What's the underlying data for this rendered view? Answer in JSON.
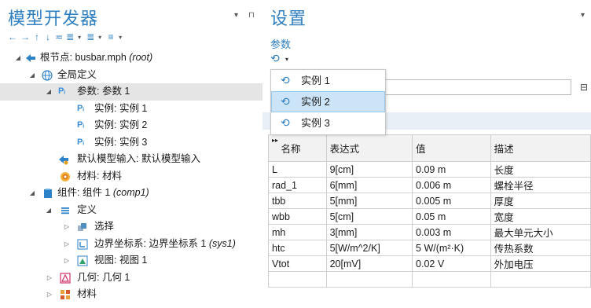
{
  "left_panel": {
    "title": "模型开发器",
    "title_controls": [
      "▾",
      "⊓"
    ],
    "toolbar": [
      "←",
      "→",
      "↑",
      "↓",
      "≂",
      "≣",
      "▾",
      "≣",
      "▾",
      "≡",
      "▾"
    ],
    "tree": [
      {
        "label": "根节点: busbar.mph",
        "suffix": "(root)",
        "icon": "root-node-icon",
        "level": 0,
        "expanded": true
      },
      {
        "label": "全局定义",
        "icon": "globe-icon",
        "level": 1,
        "expanded": true
      },
      {
        "label": "参数: 参数 1",
        "icon": "parameter-icon",
        "level": 2,
        "expanded": true,
        "selected": true
      },
      {
        "label": "实例: 实例 1",
        "icon": "parameter-icon",
        "level": 3
      },
      {
        "label": "实例: 实例 2",
        "icon": "parameter-icon",
        "level": 3
      },
      {
        "label": "实例: 实例 3",
        "icon": "parameter-icon",
        "level": 3
      },
      {
        "label": "默认模型输入: 默认模型输入",
        "icon": "model-input-icon",
        "level": 2
      },
      {
        "label": "材料: 材料",
        "icon": "material-icon",
        "level": 2
      },
      {
        "label": "组件: 组件 1",
        "suffix": "(comp1)",
        "icon": "component-icon",
        "level": 1,
        "expanded": true
      },
      {
        "label": "定义",
        "icon": "definitions-icon",
        "level": 2,
        "expanded": true
      },
      {
        "label": "选择",
        "icon": "selection-icon",
        "level": 3,
        "collapsed": true
      },
      {
        "label": "边界坐标系: 边界坐标系 1",
        "suffix": "(sys1)",
        "icon": "coordinate-system-icon",
        "level": 3,
        "collapsed": true
      },
      {
        "label": "视图: 视图 1",
        "icon": "view-icon",
        "level": 3,
        "collapsed": true
      },
      {
        "label": "几何: 几何 1",
        "icon": "geometry-icon",
        "level": 2,
        "collapsed": true
      },
      {
        "label": "材料",
        "icon": "materials-icon",
        "level": 2,
        "collapsed": true
      }
    ]
  },
  "right_panel": {
    "title": "设置",
    "title_control": "▾",
    "subtitle": "参数",
    "instance_button_icon": "⟲",
    "instance_dropdown_arrow": "▾",
    "search_button_icon": "⊟",
    "menu": {
      "items": [
        "实例 1",
        "实例 2",
        "实例 3"
      ],
      "highlighted": 1
    },
    "table": {
      "columns": [
        "名称",
        "表达式",
        "值",
        "描述"
      ],
      "sort_glyph": "▸▸",
      "rows": [
        [
          "L",
          "9[cm]",
          "0.09 m",
          "长度"
        ],
        [
          "rad_1",
          "6[mm]",
          "0.006 m",
          "螺栓半径"
        ],
        [
          "tbb",
          "5[mm]",
          "0.005 m",
          "厚度"
        ],
        [
          "wbb",
          "5[cm]",
          "0.05 m",
          "宽度"
        ],
        [
          "mh",
          "3[mm]",
          "0.003 m",
          "最大单元大小"
        ],
        [
          "htc",
          "5[W/m^2/K]",
          "5 W/(m²·K)",
          "传热系数"
        ],
        [
          "Vtot",
          "20[mV]",
          "0.02 V",
          "外加电压"
        ],
        [
          "",
          "",
          "",
          ""
        ]
      ]
    }
  }
}
